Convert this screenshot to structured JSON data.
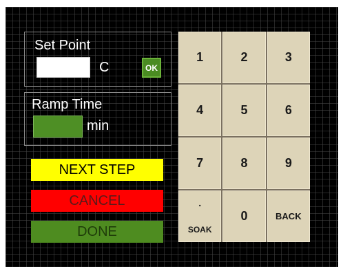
{
  "setpoint": {
    "title": "Set Point",
    "value": "",
    "unit": "C",
    "ok_label": "OK"
  },
  "ramp": {
    "title": "Ramp Time",
    "value": "",
    "unit": "min"
  },
  "actions": {
    "next_label": "NEXT STEP",
    "cancel_label": "CANCEL",
    "done_label": "DONE"
  },
  "keypad": {
    "keys": [
      "1",
      "2",
      "3",
      "4",
      "5",
      "6",
      "7",
      "8",
      "9",
      ".",
      "0",
      "BACK"
    ],
    "soak_label": "SOAK"
  },
  "colors": {
    "next": "#ffff00",
    "cancel": "#ff0000",
    "done": "#4e8c20",
    "ok": "#4a8b22",
    "key_bg": "#ddd4b8",
    "ramp_field": "#4e8f25"
  }
}
